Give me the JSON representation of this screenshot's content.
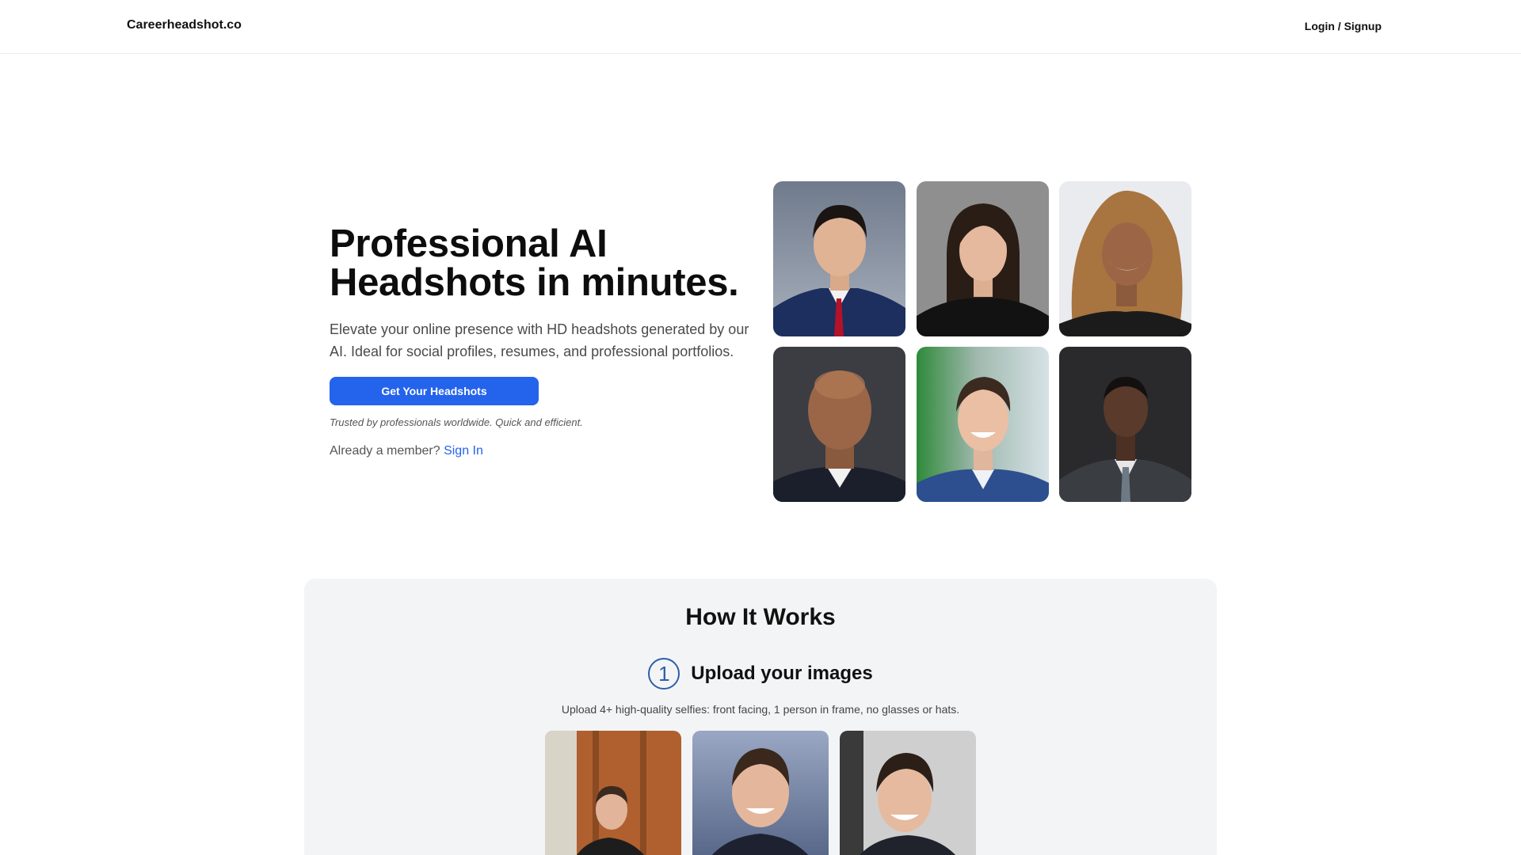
{
  "header": {
    "brand": "Careerheadshot.co",
    "login_label": "Login / Signup"
  },
  "hero": {
    "title_line1": "Professional AI",
    "title_line2": "Headshots in minutes.",
    "subtitle": "Elevate your online presence with HD headshots generated by our AI. Ideal for social profiles, resumes, and professional portfolios.",
    "cta_label": "Get Your Headshots",
    "trusted_text": "Trusted by professionals worldwide. Quick and efficient.",
    "member_prompt": "Already a member?",
    "sign_in_label": "Sign In",
    "accent_color": "#2463eb"
  },
  "how_it_works": {
    "title": "How It Works",
    "step_number": "1",
    "step_title": "Upload your images",
    "step_description": "Upload 4+ high-quality selfies: front facing, 1 person in frame, no glasses or hats."
  }
}
